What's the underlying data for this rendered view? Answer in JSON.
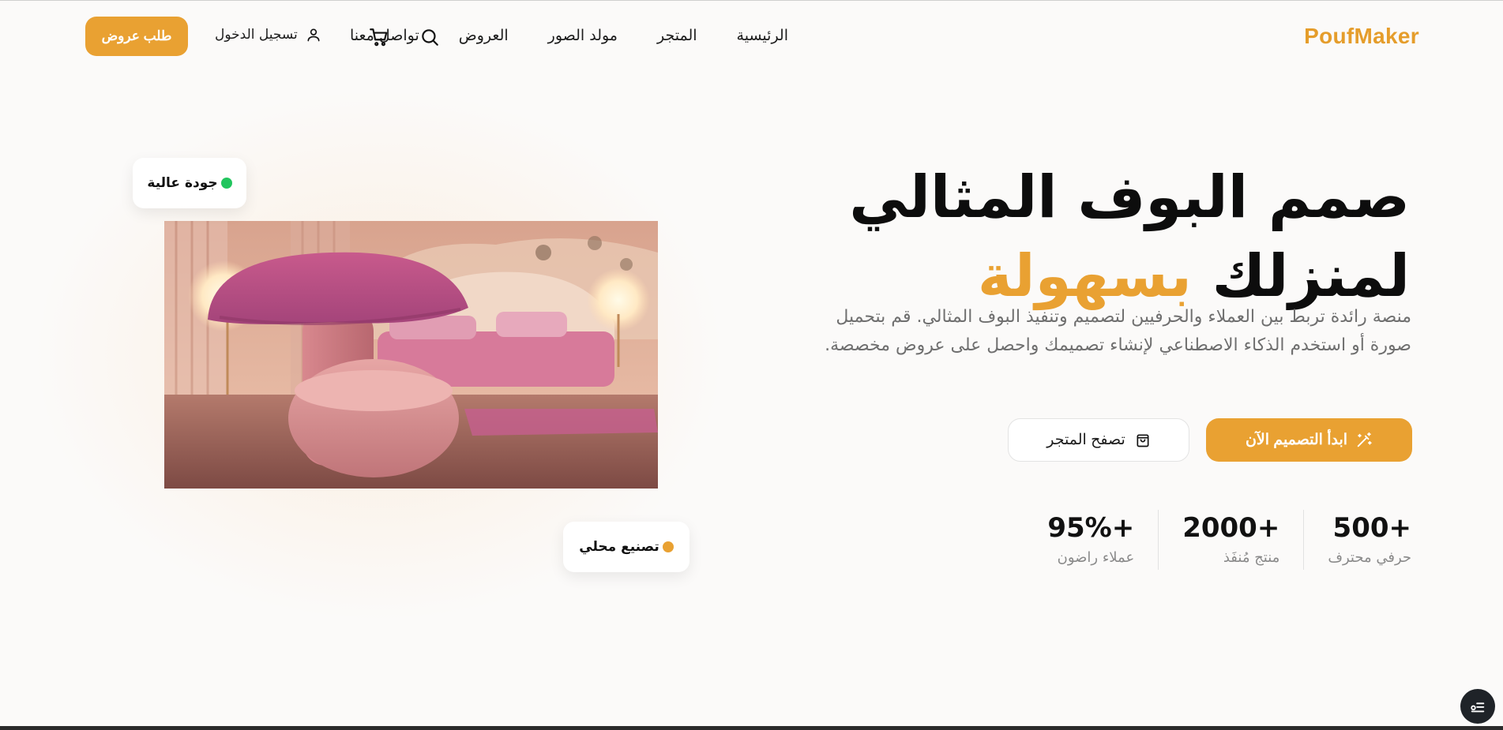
{
  "brand": {
    "logo_text": "PoufMaker",
    "accent_color": "#e9a132"
  },
  "nav": {
    "items": [
      {
        "label": "الرئيسية"
      },
      {
        "label": "المتجر"
      },
      {
        "label": "مولد الصور"
      },
      {
        "label": "العروض"
      },
      {
        "label": "تواصل معنا"
      }
    ]
  },
  "header": {
    "search_icon": "search-icon",
    "cart_icon": "cart-icon",
    "login_label": "تسجيل الدخول",
    "offers_button": "طلب عروض"
  },
  "hero": {
    "title_line1": "صمم البوف المثالي",
    "title_line2_part1": "لمنزلك",
    "title_line2_accent": "بسهولة",
    "description": "منصة رائدة تربط بين العملاء والحرفيين لتصميم وتنفيذ البوف المثالي. قم بتحميل صورة أو استخدم الذكاء الاصطناعي لإنشاء تصميمك واحصل على عروض مخصصة.",
    "primary_cta": "ابدأ التصميم الآن",
    "secondary_cta": "تصفح المتجر"
  },
  "stats": [
    {
      "value": "500+",
      "label": "حرفي محترف"
    },
    {
      "value": "2000+",
      "label": "منتج مُنفَذ"
    },
    {
      "value": "95%+",
      "label": "عملاء راضون"
    }
  ],
  "badges": {
    "quality": {
      "label": "جودة عالية",
      "dot_color": "#22c55e"
    },
    "local": {
      "label": "تصنيع محلي",
      "dot_color": "#e9a132"
    }
  }
}
